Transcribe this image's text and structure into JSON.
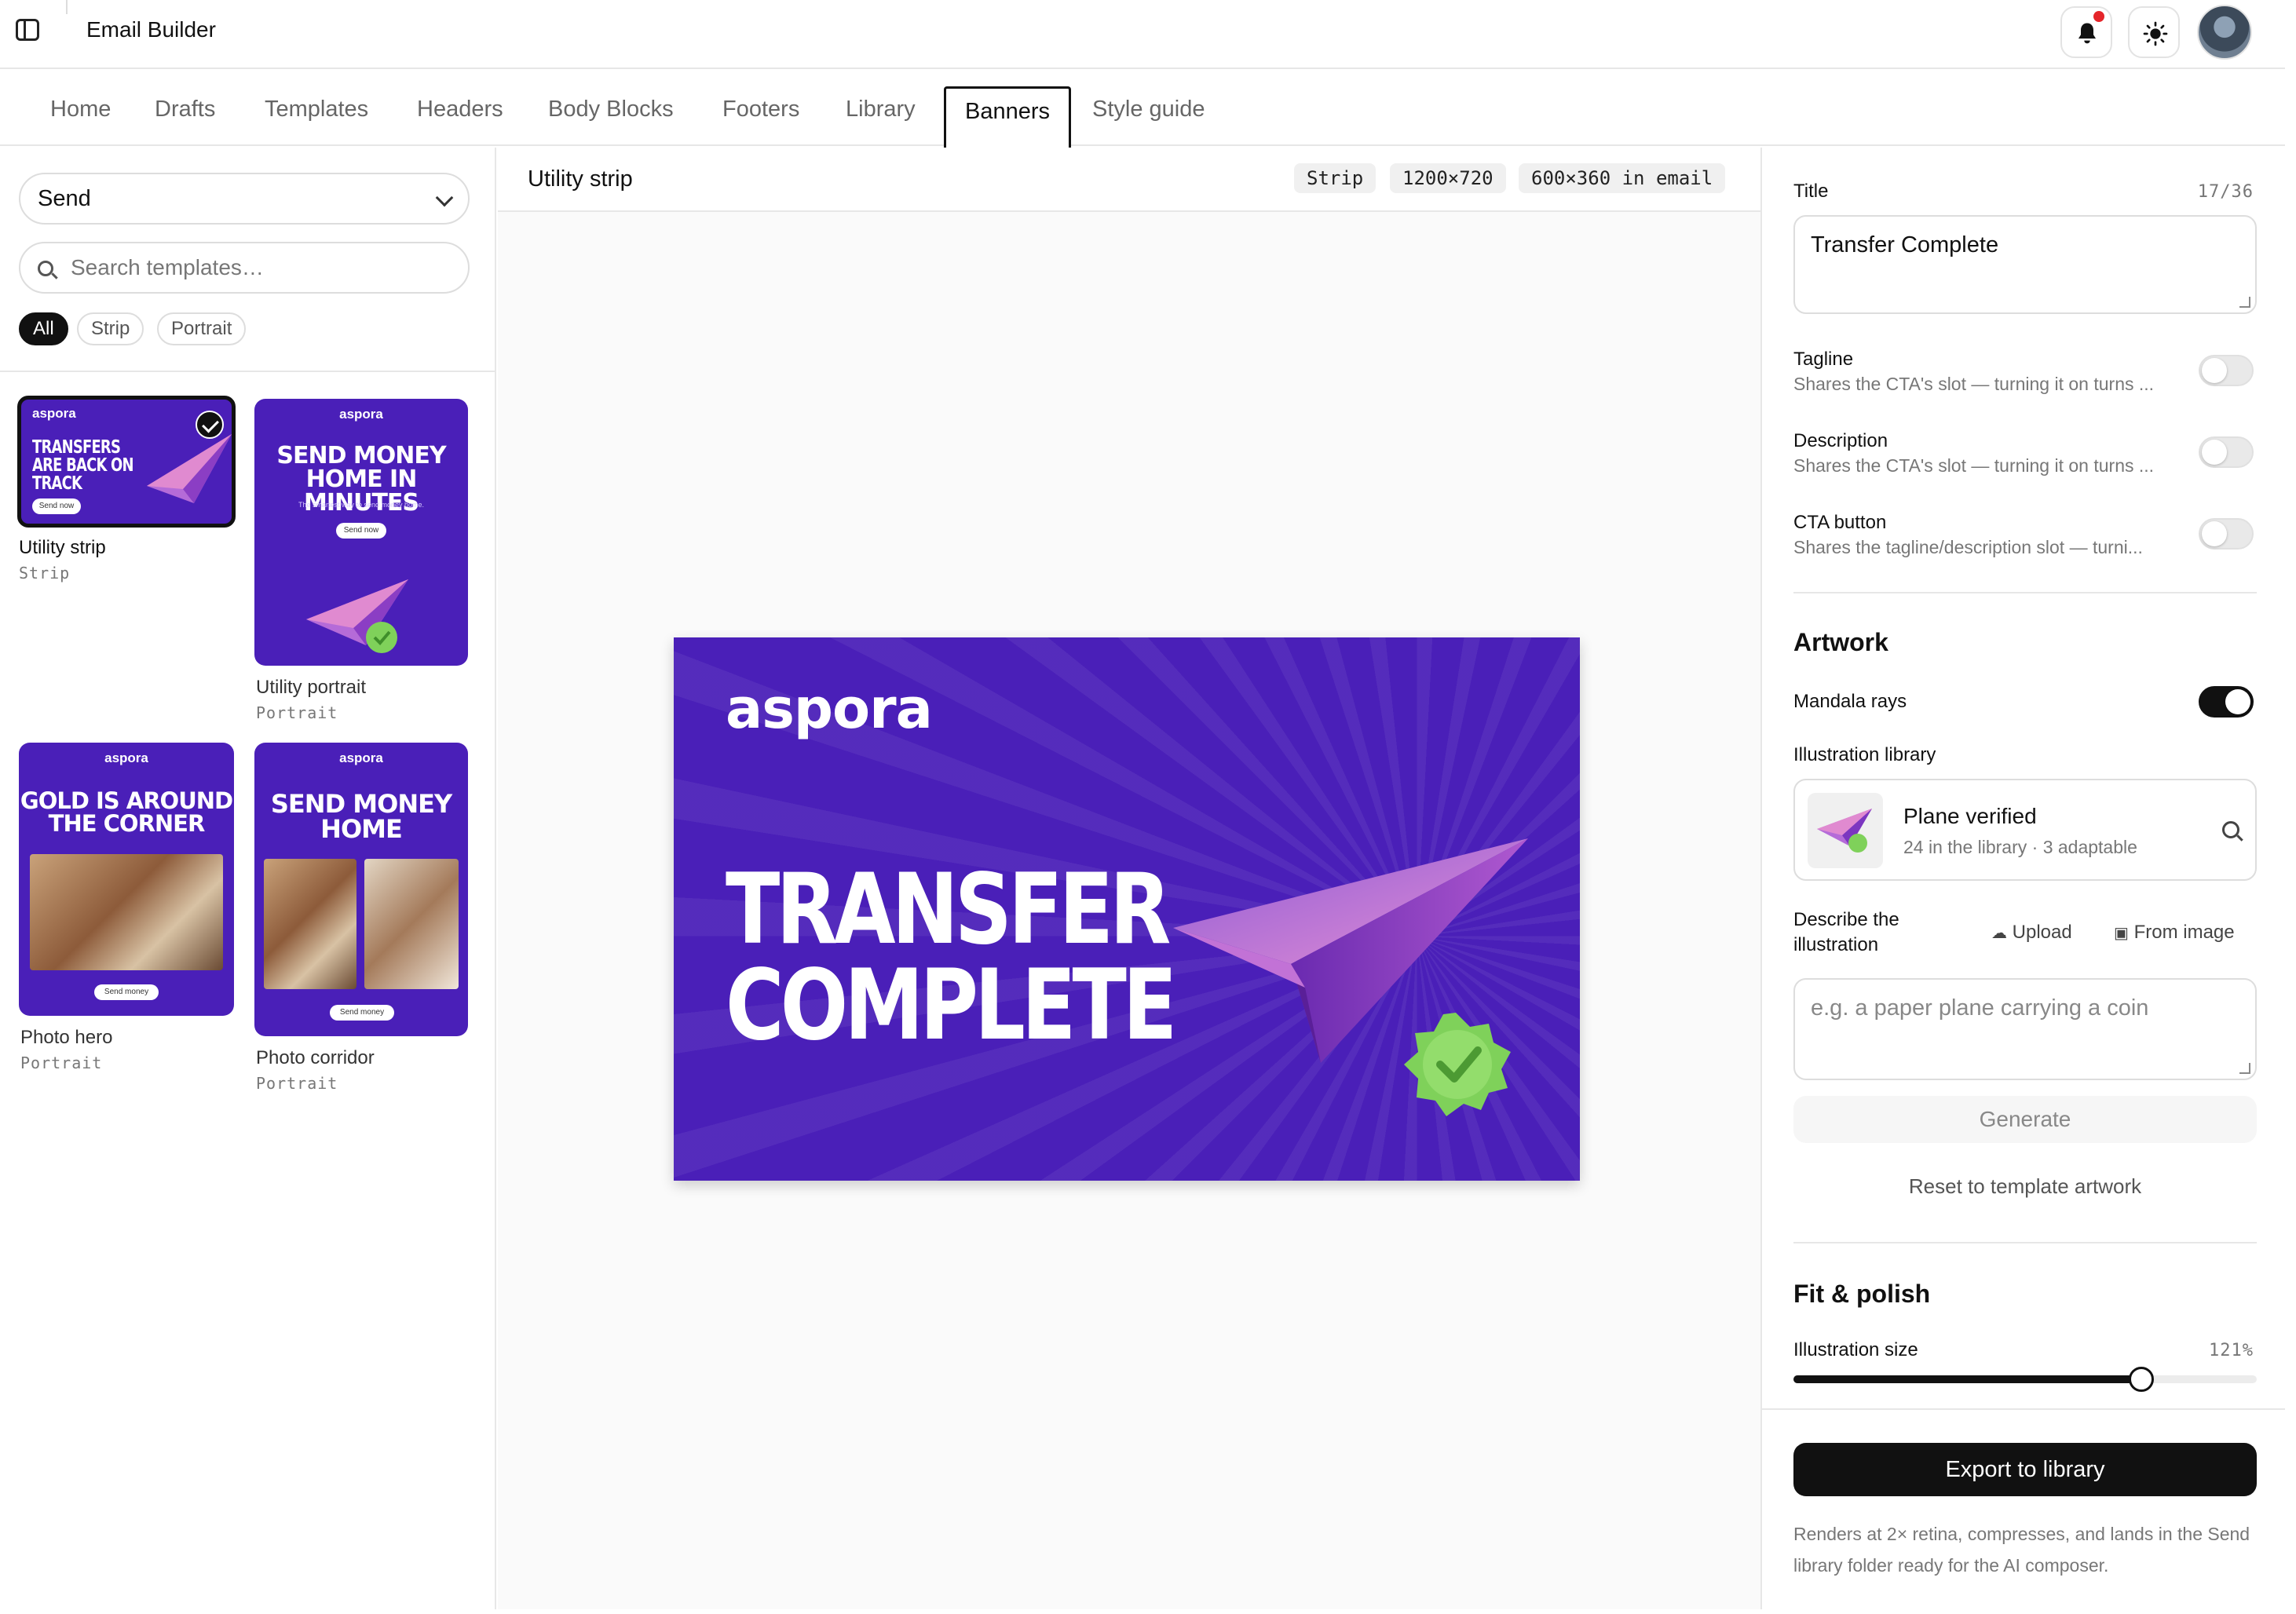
{
  "app": {
    "title": "Email Builder"
  },
  "nav": {
    "tabs": [
      {
        "label": "Home"
      },
      {
        "label": "Drafts"
      },
      {
        "label": "Templates"
      },
      {
        "label": "Headers"
      },
      {
        "label": "Body Blocks"
      },
      {
        "label": "Footers"
      },
      {
        "label": "Library"
      },
      {
        "label": "Banners"
      },
      {
        "label": "Style guide"
      }
    ],
    "active": "Banners"
  },
  "sidebar": {
    "brand_select": "Send",
    "search_placeholder": "Search templates…",
    "filters": [
      "All",
      "Strip",
      "Portrait"
    ],
    "active_filter": "All",
    "templates": [
      {
        "label": "Utility strip",
        "type": "Strip",
        "selected": true,
        "logo": "aspora",
        "headline": "TRANSFERS ARE BACK ON TRACK",
        "cta": "Send now"
      },
      {
        "label": "Utility portrait",
        "type": "Portrait",
        "selected": false,
        "logo": "aspora",
        "headline": "SEND MONEY HOME IN MINUTES",
        "sub": "The smartest way to send money home.",
        "cta": "Send now"
      },
      {
        "label": "Photo hero",
        "type": "Portrait",
        "selected": false,
        "logo": "aspora",
        "headline": "GOLD IS AROUND THE CORNER",
        "cta": "Send money"
      },
      {
        "label": "Photo corridor",
        "type": "Portrait",
        "selected": false,
        "logo": "aspora",
        "headline": "SEND MONEY HOME",
        "cta": "Send money"
      }
    ]
  },
  "canvas": {
    "title": "Utility strip",
    "badges": [
      "Strip",
      "1200×720",
      "600×360 in email"
    ],
    "banner": {
      "logo": "aspora",
      "headline": "TRANSFER COMPLETE",
      "bg_color": "#4a1fb8",
      "badge_color": "#7fd15a"
    }
  },
  "panel": {
    "title_label": "Title",
    "title_counter": "17/36",
    "title_value": "Transfer Complete",
    "toggles": [
      {
        "label": "Tagline",
        "desc": "Shares the CTA's slot — turning it on turns ...",
        "on": false
      },
      {
        "label": "Description",
        "desc": "Shares the CTA's slot — turning it on turns ...",
        "on": false
      },
      {
        "label": "CTA button",
        "desc": "Shares the tagline/description slot — turni...",
        "on": false
      }
    ],
    "artwork": {
      "heading": "Artwork",
      "mandala_label": "Mandala rays",
      "mandala_on": true,
      "library_label": "Illustration library",
      "library_item": {
        "name": "Plane verified",
        "meta": "24 in the library · 3 adaptable"
      },
      "describe_label": "Describe the illustration",
      "upload": "Upload",
      "from_image": "From image",
      "describe_placeholder": "e.g. a paper plane carrying a coin",
      "generate": "Generate",
      "reset": "Reset to template artwork"
    },
    "fit": {
      "heading": "Fit & polish",
      "size_label": "Illustration size",
      "size_value": "121%",
      "size_fraction": 0.75
    },
    "export": {
      "button": "Export to library",
      "note": "Renders at 2× retina, compresses, and lands in the Send library folder ready for the AI composer."
    }
  }
}
